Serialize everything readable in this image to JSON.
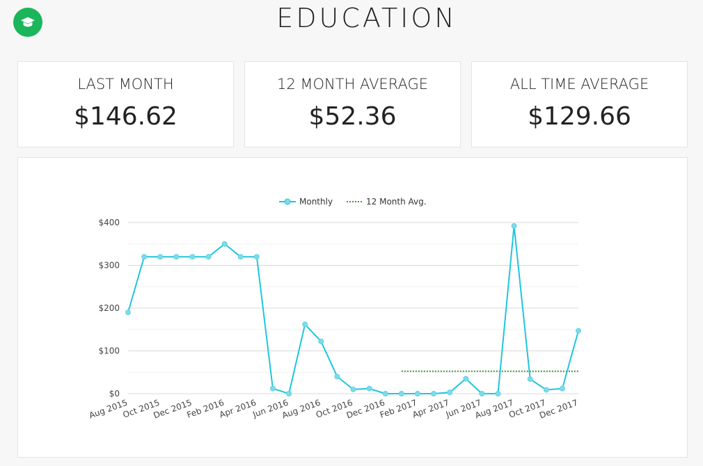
{
  "header": {
    "title": "EDUCATION",
    "icon": "graduation-cap-icon",
    "icon_color": "#1bb55c"
  },
  "stats": [
    {
      "label": "LAST MONTH",
      "value": "$146.62"
    },
    {
      "label": "12 MONTH AVERAGE",
      "value": "$52.36"
    },
    {
      "label": "ALL TIME AVERAGE",
      "value": "$129.66"
    }
  ],
  "chart_data": {
    "type": "line",
    "x": [
      "Aug 2015",
      "Sep 2015",
      "Oct 2015",
      "Nov 2015",
      "Dec 2015",
      "Jan 2016",
      "Feb 2016",
      "Mar 2016",
      "Apr 2016",
      "May 2016",
      "Jun 2016",
      "Jul 2016",
      "Aug 2016",
      "Sep 2016",
      "Oct 2016",
      "Nov 2016",
      "Dec 2016",
      "Jan 2017",
      "Feb 2017",
      "Mar 2017",
      "Apr 2017",
      "May 2017",
      "Jun 2017",
      "Jul 2017",
      "Aug 2017",
      "Sep 2017",
      "Oct 2017",
      "Nov 2017",
      "Dec 2017"
    ],
    "x_tick_labels": [
      "Aug 2015",
      "Oct 2015",
      "Dec 2015",
      "Feb 2016",
      "Apr 2016",
      "Jun 2016",
      "Aug 2016",
      "Oct 2016",
      "Dec 2016",
      "Feb 2017",
      "Apr 2017",
      "Jun 2017",
      "Aug 2017",
      "Oct 2017",
      "Dec 2017"
    ],
    "series": [
      {
        "name": "Monthly",
        "color": "#1ec6dc",
        "values": [
          190,
          320,
          320,
          320,
          320,
          320,
          350,
          320,
          320,
          12,
          0,
          162,
          122,
          40,
          10,
          12,
          0,
          0,
          0,
          0,
          3,
          35,
          0,
          0,
          392,
          34,
          9,
          12,
          147
        ]
      },
      {
        "name": "12 Month Avg.",
        "color": "#3a9a2a",
        "style": "dotted",
        "x_range": [
          "Jan 2017",
          "Dec 2017"
        ],
        "value": 52.36
      }
    ],
    "ylim": [
      0,
      400
    ],
    "y_ticks": [
      0,
      100,
      200,
      300,
      400
    ],
    "y_tick_labels": [
      "$0",
      "$100",
      "$200",
      "$300",
      "$400"
    ],
    "grid": true,
    "legend": "top-center"
  }
}
